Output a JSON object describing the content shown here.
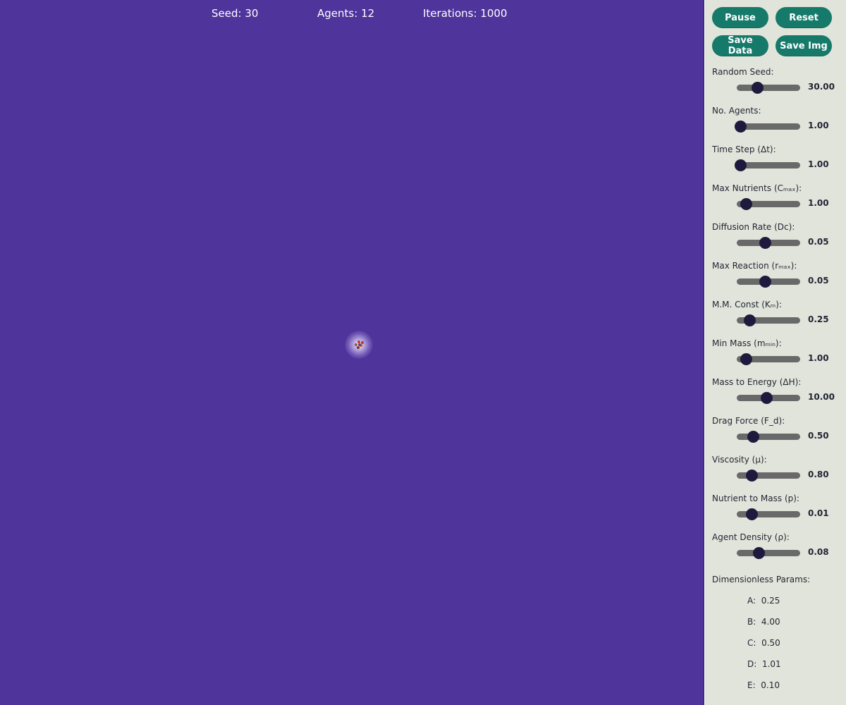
{
  "stats": {
    "seed": {
      "label": "Seed:",
      "value": "30"
    },
    "agents": {
      "label": "Agents:",
      "value": "12"
    },
    "iterations": {
      "label": "Iterations:",
      "value": "1000"
    }
  },
  "buttons": {
    "pause": "Pause",
    "reset": "Reset",
    "save_data": "Save Data",
    "save_img": "Save Img"
  },
  "params": [
    {
      "label": "Random Seed:",
      "value": "30.00",
      "level": 0.32
    },
    {
      "label": "No. Agents:",
      "value": "1.00",
      "level": 0.05
    },
    {
      "label": "Time Step (Δt):",
      "value": "1.00",
      "level": 0.05
    },
    {
      "label": "Max Nutrients (Cₘₐₓ):",
      "value": "1.00",
      "level": 0.14
    },
    {
      "label": "Diffusion Rate (Dc):",
      "value": "0.05",
      "level": 0.44
    },
    {
      "label": "Max Reaction (rₘₐₓ):",
      "value": "0.05",
      "level": 0.44
    },
    {
      "label": "M.M. Const (Kₘ):",
      "value": "0.25",
      "level": 0.2
    },
    {
      "label": "Min Mass (mₘᵢₙ):",
      "value": "1.00",
      "level": 0.14
    },
    {
      "label": "Mass to Energy (ΔH):",
      "value": "10.00",
      "level": 0.47
    },
    {
      "label": "Drag Force (F_d):",
      "value": "0.50",
      "level": 0.25
    },
    {
      "label": "Viscosity (μ):",
      "value": "0.80",
      "level": 0.23
    },
    {
      "label": "Nutrient to Mass (p):",
      "value": "0.01",
      "level": 0.23
    },
    {
      "label": "Agent Density (ρ):",
      "value": "0.08",
      "level": 0.34
    }
  ],
  "dimensionless": {
    "title": "Dimensionless Params:",
    "rows": [
      {
        "label": "A:",
        "value": "0.25"
      },
      {
        "label": "B:",
        "value": "4.00"
      },
      {
        "label": "C:",
        "value": "0.50"
      },
      {
        "label": "D:",
        "value": "1.01"
      },
      {
        "label": "E:",
        "value": "0.10"
      }
    ]
  },
  "colors": {
    "canvas_bg": "#4e349b",
    "panel_bg": "#e1e4da",
    "button": "#167a6b",
    "slider_track": "#696969",
    "slider_thumb": "#1f1a3d"
  }
}
